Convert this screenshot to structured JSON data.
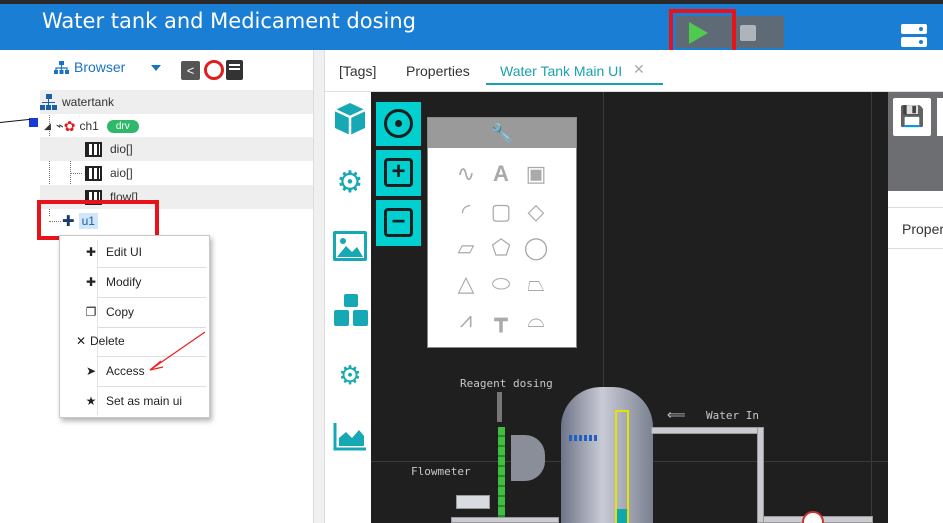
{
  "header": {
    "title": "Water tank and Medicament dosing"
  },
  "browser": {
    "tab_label": "Browser"
  },
  "tree": {
    "root": "watertank",
    "channel": "ch1",
    "channel_badge": "drv",
    "items": [
      "dio[]",
      "aio[]",
      "flow[]"
    ],
    "ui_node": "u1"
  },
  "context_menu": {
    "items": [
      {
        "label": "Edit UI",
        "icon": "puzzle-icon"
      },
      {
        "label": "Modify",
        "icon": "puzzle-icon"
      },
      {
        "label": "Copy",
        "icon": "copy-icon"
      },
      {
        "label": "Delete",
        "icon": "close-icon"
      },
      {
        "label": "Access",
        "icon": "paper-plane-icon"
      },
      {
        "label": "Set as main ui",
        "icon": "star-icon"
      }
    ]
  },
  "tabs": [
    {
      "label": "[Tags]"
    },
    {
      "label": "Properties"
    },
    {
      "label": "Water Tank Main UI",
      "active": true
    }
  ],
  "diagram": {
    "reagent_label": "Reagent dosing",
    "water_in_label": "Water In",
    "flowmeter_label": "Flowmeter",
    "water_in_arrow": "⟸"
  },
  "properties_panel": {
    "label": "Proper"
  },
  "colors": {
    "header_bg": "#1a7ed4",
    "accent": "#1aa1ad",
    "highlight_box": "#e8121a",
    "canvas_bg": "#1f1f1f"
  }
}
